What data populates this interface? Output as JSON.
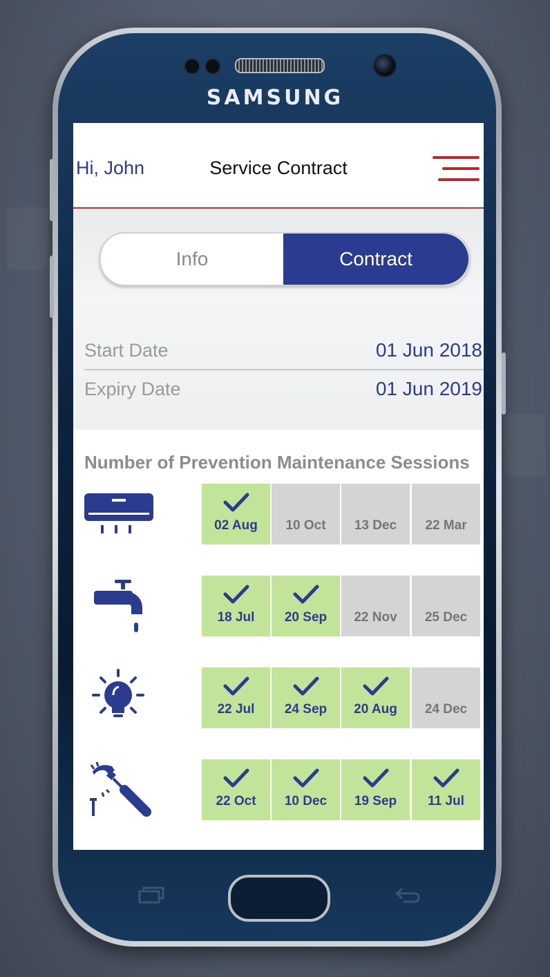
{
  "device": {
    "brand": "SAMSUNG"
  },
  "header": {
    "greeting": "Hi, John",
    "title": "Service Contract"
  },
  "tabs": [
    {
      "label": "Info",
      "active": false
    },
    {
      "label": "Contract",
      "active": true
    }
  ],
  "contract": {
    "start_label": "Start Date",
    "start_value": "01 Jun 2018",
    "expiry_label": "Expiry Date",
    "expiry_value": "01 Jun 2019"
  },
  "sessions": {
    "title": "Number of Prevention Maintenance Sessions",
    "rows": [
      {
        "icon": "air-conditioner-icon",
        "cells": [
          {
            "date": "02 Aug",
            "done": true
          },
          {
            "date": "10 Oct",
            "done": false
          },
          {
            "date": "13 Dec",
            "done": false
          },
          {
            "date": "22 Mar",
            "done": false
          }
        ]
      },
      {
        "icon": "water-tap-icon",
        "cells": [
          {
            "date": "18 Jul",
            "done": true
          },
          {
            "date": "20 Sep",
            "done": true
          },
          {
            "date": "22 Nov",
            "done": false
          },
          {
            "date": "25 Dec",
            "done": false
          }
        ]
      },
      {
        "icon": "light-bulb-icon",
        "cells": [
          {
            "date": "22 Jul",
            "done": true
          },
          {
            "date": "24 Sep",
            "done": true
          },
          {
            "date": "20 Aug",
            "done": true
          },
          {
            "date": "24 Dec",
            "done": false
          }
        ]
      },
      {
        "icon": "hammer-screwdriver-icon",
        "cells": [
          {
            "date": "22 Oct",
            "done": true
          },
          {
            "date": "10 Dec",
            "done": true
          },
          {
            "date": "19 Sep",
            "done": true
          },
          {
            "date": "11 Jul",
            "done": true
          }
        ]
      }
    ]
  },
  "colors": {
    "brand_blue": "#2b3b8f",
    "accent_red": "#b52a2a",
    "done_green": "#c2e49a",
    "pending_gray": "#d4d4d4"
  }
}
